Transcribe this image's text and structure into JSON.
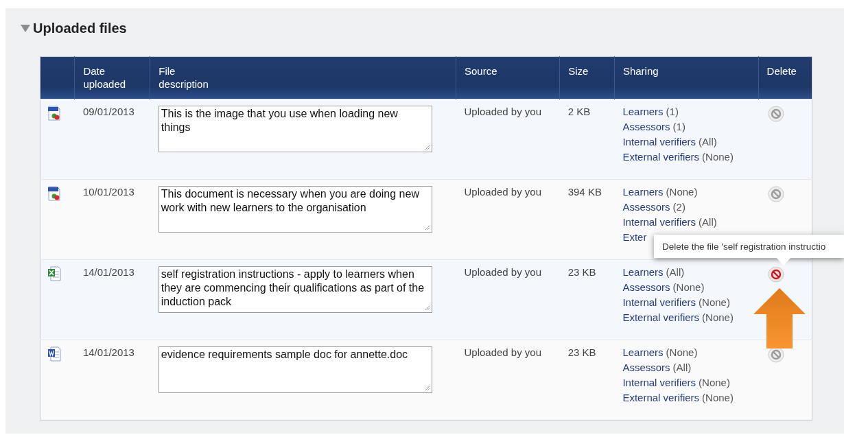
{
  "section": {
    "title": "Uploaded files",
    "expanded": true
  },
  "table": {
    "columns": [
      "",
      "Date uploaded",
      "File description",
      "Source",
      "Size",
      "Sharing",
      "Delete"
    ],
    "rows": [
      {
        "kind": "jpg",
        "date": "09/01/2013",
        "description": "This is the image that you use when loading new things",
        "source": "Uploaded by you",
        "size": "2 KB",
        "sharing": [
          {
            "label": "Learners",
            "count": "(1)"
          },
          {
            "label": "Assessors",
            "count": "(1)"
          },
          {
            "label": "Internal verifiers",
            "count": "(All)"
          },
          {
            "label": "External verifiers",
            "count": "(None)"
          }
        ],
        "delete_highlighted": false
      },
      {
        "kind": "jpg",
        "date": "10/01/2013",
        "description": "This document is necessary when you are doing new work with new learners to the organisation",
        "source": "Uploaded by you",
        "size": "394 KB",
        "sharing": [
          {
            "label": "Learners",
            "count": "(None)"
          },
          {
            "label": "Assessors",
            "count": "(2)"
          },
          {
            "label": "Internal verifiers",
            "count": "(All)"
          },
          {
            "label": "Exter"
          }
        ],
        "delete_highlighted": false
      },
      {
        "kind": "xls",
        "date": "14/01/2013",
        "description": "self registration instructions - apply to learners when they are commencing their qualifications as part of the induction pack",
        "source": "Uploaded by you",
        "size": "23 KB",
        "sharing": [
          {
            "label": "Learners",
            "count": "(All)"
          },
          {
            "label": "Assessors",
            "count": "(None)"
          },
          {
            "label": "Internal verifiers",
            "count": "(None)"
          },
          {
            "label": "External verifiers",
            "count": "(None)"
          }
        ],
        "delete_highlighted": true
      },
      {
        "kind": "doc",
        "date": "14/01/2013",
        "description": "evidence requirements sample doc for annette.doc",
        "source": "Uploaded by you",
        "size": "23 KB",
        "sharing": [
          {
            "label": "Learners",
            "count": "(None)"
          },
          {
            "label": "Assessors",
            "count": "(All)"
          },
          {
            "label": "Internal verifiers",
            "count": "(None)"
          },
          {
            "label": "External verifiers",
            "count": "(None)"
          }
        ],
        "delete_highlighted": false
      }
    ]
  },
  "tooltip": {
    "text": "Delete the file 'self registration instructio"
  }
}
